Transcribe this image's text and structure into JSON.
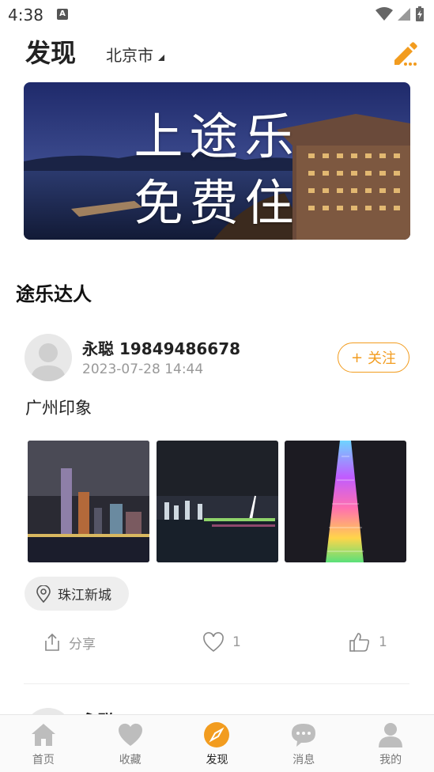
{
  "status_bar": {
    "time": "4:38",
    "notif_letter": "A"
  },
  "header": {
    "title": "发现",
    "city": "北京市"
  },
  "banner": {
    "line1": "上途乐",
    "line2": "免费住"
  },
  "section": {
    "title": "途乐达人"
  },
  "post": {
    "user_name": "永聪 19849486678",
    "time": "2023-07-28 14:44",
    "follow_label": "关注",
    "follow_plus": "+",
    "text": "广州印象",
    "location": "珠江新城",
    "share_label": "分享",
    "like_count": "1",
    "thumb_count": "1"
  },
  "next_post": {
    "user_name": "永聪"
  },
  "tabs": [
    {
      "label": "首页",
      "icon": "home-icon"
    },
    {
      "label": "收藏",
      "icon": "heart-icon"
    },
    {
      "label": "发现",
      "icon": "compass-icon"
    },
    {
      "label": "消息",
      "icon": "message-icon"
    },
    {
      "label": "我的",
      "icon": "person-icon"
    }
  ],
  "colors": {
    "accent": "#f29c1f",
    "tab_inactive": "#bdbdbd"
  }
}
